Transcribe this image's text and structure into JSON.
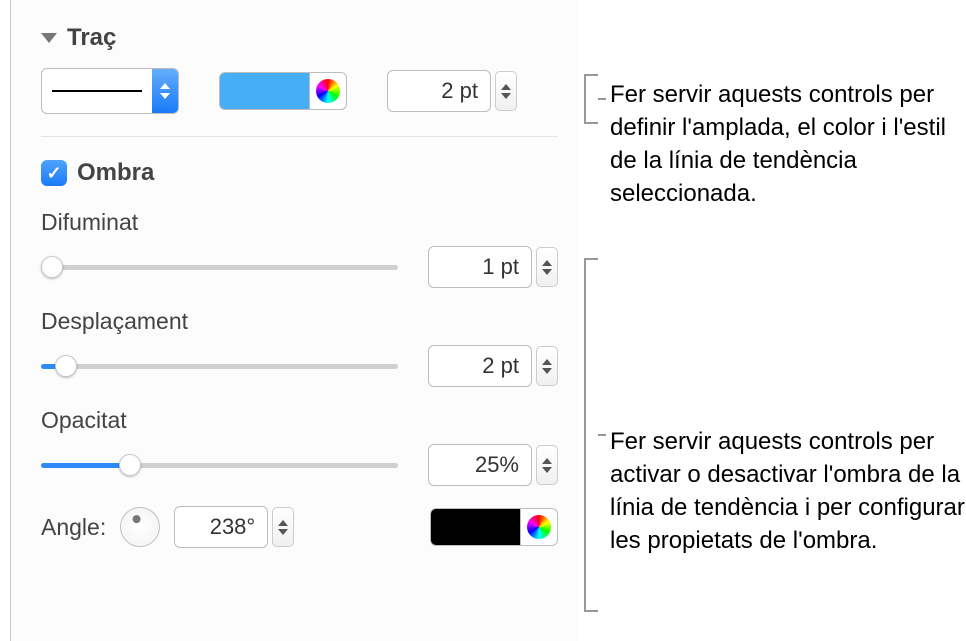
{
  "stroke": {
    "title": "Traç",
    "width_value": "2 pt",
    "color": "#46aef7"
  },
  "shadow": {
    "label": "Ombra",
    "checked": true,
    "blur": {
      "label": "Difuminat",
      "value": "1 pt",
      "percent": 3
    },
    "offset": {
      "label": "Desplaçament",
      "value": "2 pt",
      "percent": 7
    },
    "opacity": {
      "label": "Opacitat",
      "value": "25%",
      "percent": 25
    },
    "angle": {
      "label": "Angle:",
      "value": "238°",
      "degrees": 238
    },
    "shadow_color": "#000000"
  },
  "callouts": {
    "stroke": "Fer servir aquests controls per definir l'amplada, el color i l'estil de la línia de tendència seleccionada.",
    "shadow": "Fer servir aquests controls per activar o desactivar l'ombra de la línia de tendència i per configurar les propietats de l'ombra."
  }
}
